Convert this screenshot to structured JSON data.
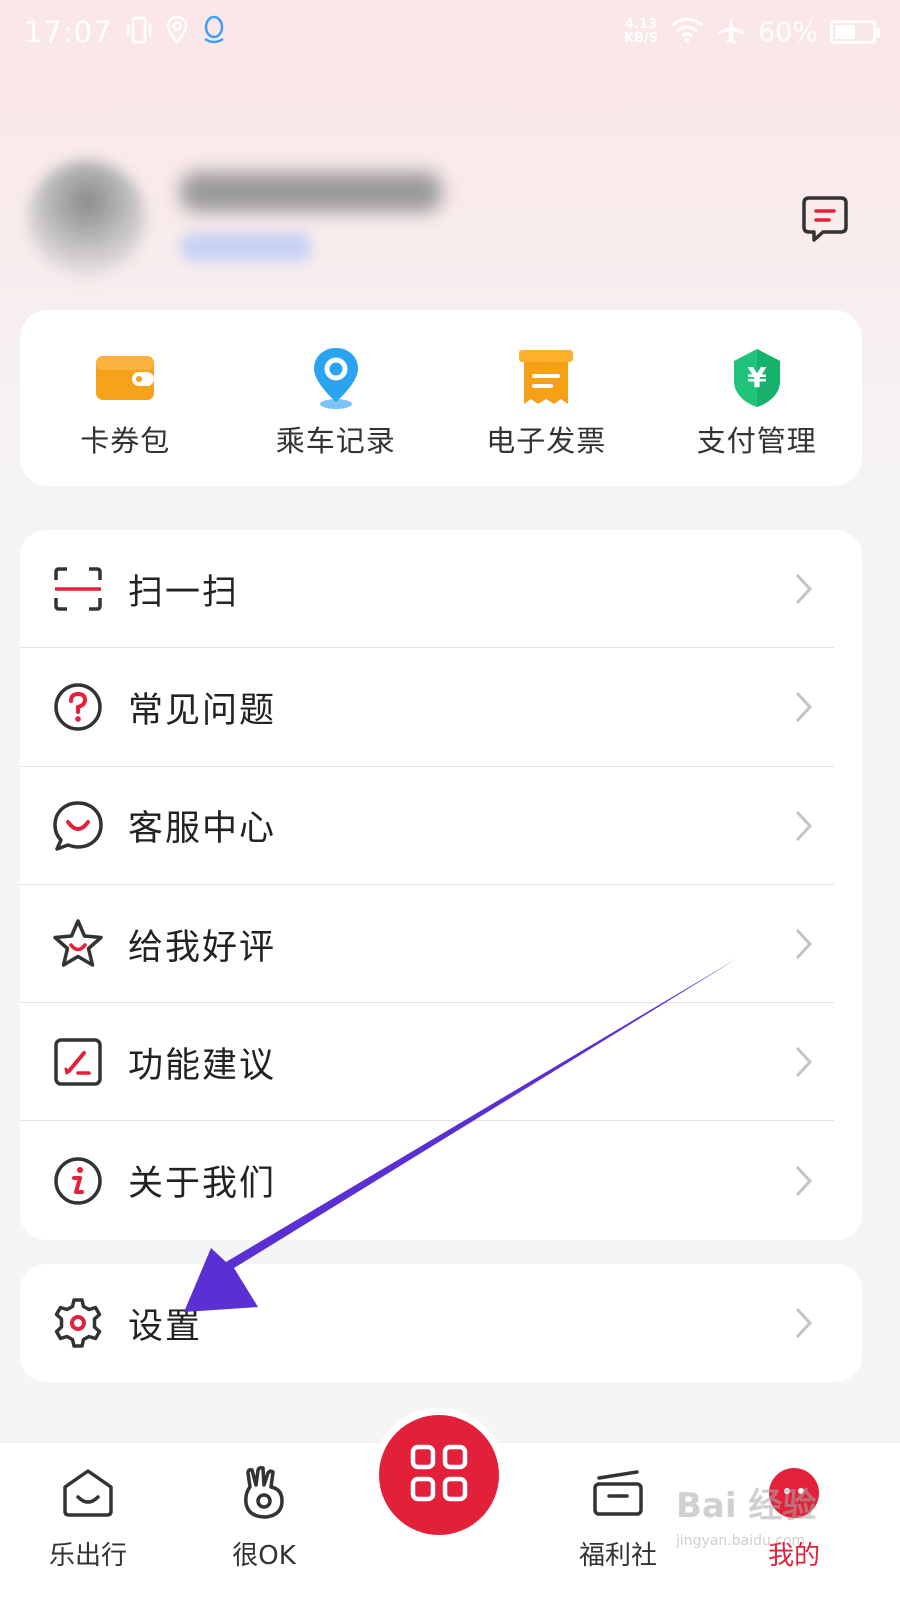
{
  "status_bar": {
    "time": "17:07",
    "speed_value": "4.13",
    "speed_unit": "KB/S",
    "battery_percent": "60%",
    "battery_level": 0.6,
    "icons": [
      "vibrate-icon",
      "location-icon",
      "qq-icon",
      "wifi-icon",
      "airplane-icon",
      "battery-icon"
    ]
  },
  "profile": {
    "name": "",
    "badge": ""
  },
  "quick_actions": [
    {
      "label": "卡券包",
      "icon": "wallet-icon",
      "color": "#f7a21b"
    },
    {
      "label": "乘车记录",
      "icon": "map-pin-icon",
      "color": "#2aa3f0"
    },
    {
      "label": "电子发票",
      "icon": "invoice-icon",
      "color": "#f6a015"
    },
    {
      "label": "支付管理",
      "icon": "yuan-shield-icon",
      "color": "#1fc47a"
    }
  ],
  "menu": [
    {
      "label": "扫一扫",
      "icon": "scan-icon"
    },
    {
      "label": "常见问题",
      "icon": "question-icon"
    },
    {
      "label": "客服中心",
      "icon": "chat-smile-icon"
    },
    {
      "label": "给我好评",
      "icon": "star-icon"
    },
    {
      "label": "功能建议",
      "icon": "edit-icon"
    },
    {
      "label": "关于我们",
      "icon": "info-icon"
    }
  ],
  "settings_menu": {
    "label": "设置",
    "icon": "gear-icon"
  },
  "bottom_nav": [
    {
      "label": "乐出行",
      "icon": "home-icon",
      "active": false
    },
    {
      "label": "很OK",
      "icon": "ok-hand-icon",
      "active": false
    },
    {
      "label": "",
      "icon": "qr-code-icon",
      "active": false
    },
    {
      "label": "福利社",
      "icon": "gift-box-icon",
      "active": false
    },
    {
      "label": "我的",
      "icon": "profile-face-icon",
      "active": true
    }
  ],
  "watermark": {
    "text": "Bai 经验",
    "sub": "jingyan.baidu.com"
  },
  "colors": {
    "accent": "#e3213a",
    "annotation_arrow": "#5a2fd3",
    "icon_dark": "#333333"
  }
}
